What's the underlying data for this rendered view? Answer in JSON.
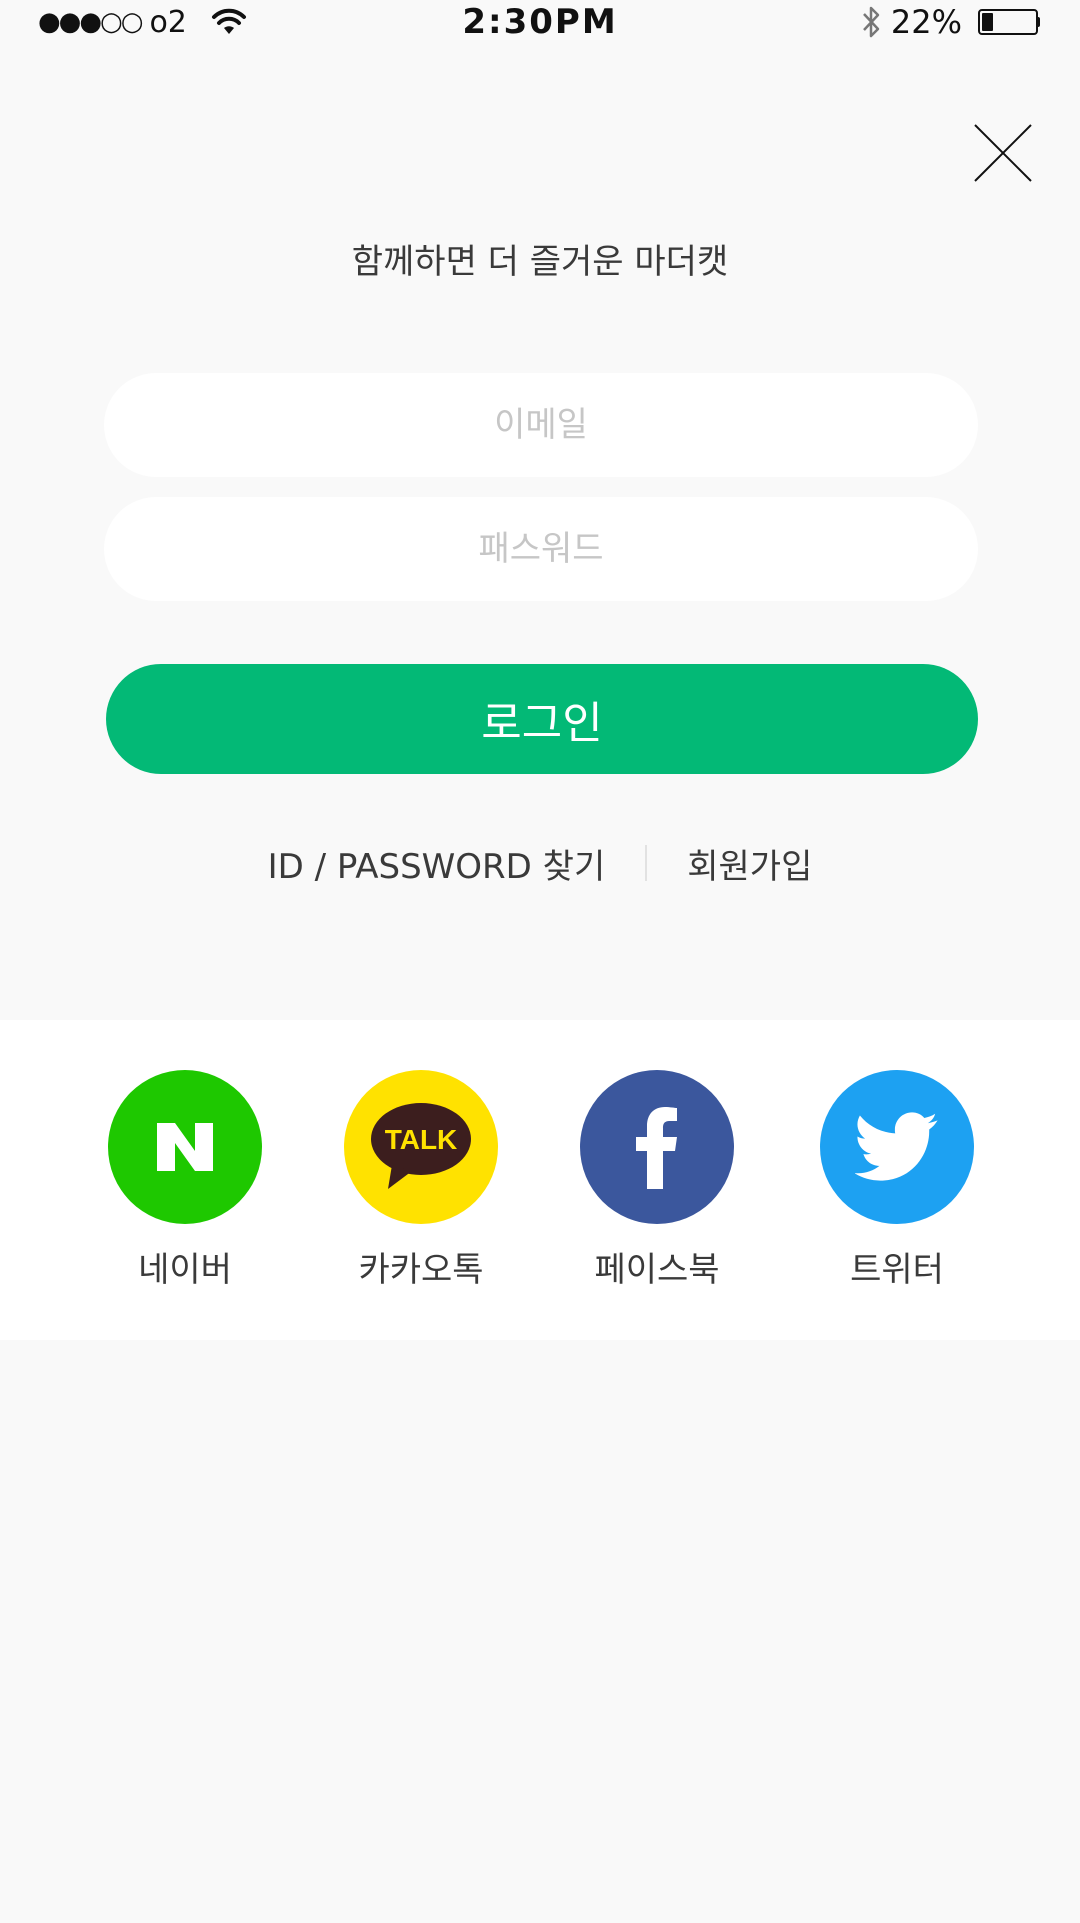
{
  "status_bar": {
    "signal": "●●●○○",
    "carrier": "o2",
    "time": "2:30PM",
    "battery_percent": "22%",
    "battery_level": 0.22,
    "icons": [
      "wifi-icon",
      "bluetooth-icon",
      "battery-icon"
    ]
  },
  "close_icon": "close-icon",
  "tagline": "함께하면 더 즐거운 마더캣",
  "form": {
    "email_placeholder": "이메일",
    "email_value": "",
    "password_placeholder": "패스워드",
    "password_value": "",
    "login_label": "로그인"
  },
  "links": {
    "find_account": "ID / PASSWORD 찾기",
    "signup": "회원가입"
  },
  "social": [
    {
      "label": "네이버",
      "icon": "naver-icon",
      "color": "#1ec800"
    },
    {
      "label": "카카오톡",
      "icon": "kakaotalk-icon",
      "color": "#ffe200",
      "glyph": "TALK"
    },
    {
      "label": "페이스북",
      "icon": "facebook-icon",
      "color": "#3b579d"
    },
    {
      "label": "트위터",
      "icon": "twitter-icon",
      "color": "#1da1f2"
    }
  ],
  "colors": {
    "accent": "#03b976",
    "background": "#f9f9f9",
    "panel": "#ffffff"
  }
}
